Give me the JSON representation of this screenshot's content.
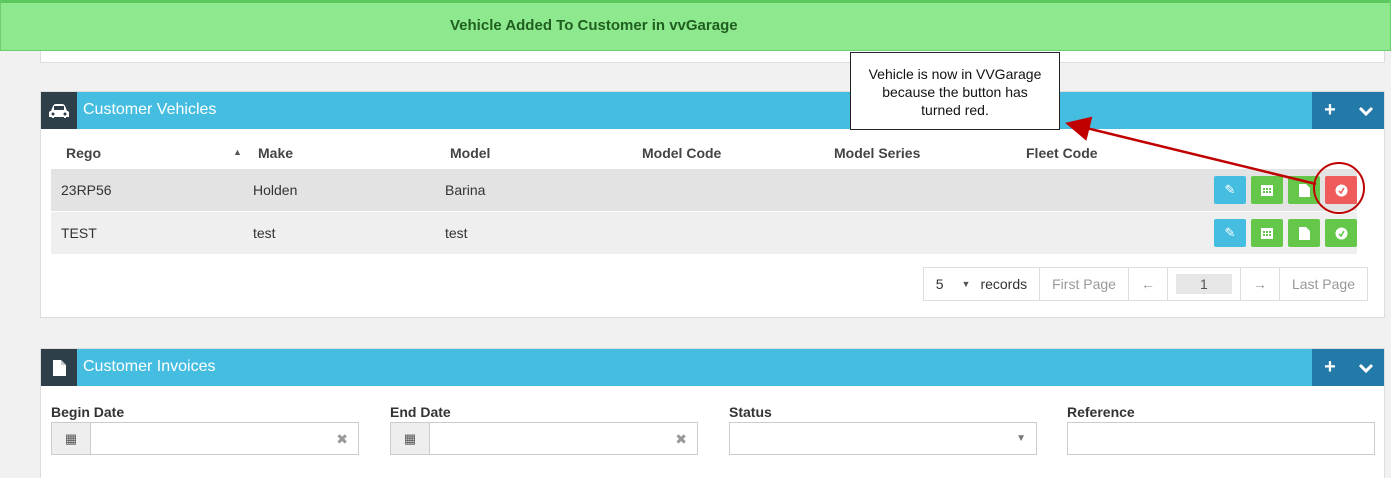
{
  "banner": {
    "message": "Vehicle Added To Customer in vvGarage"
  },
  "callout": {
    "line1": "Vehicle is now in VVGarage",
    "line2": "because the button has",
    "line3": "turned red."
  },
  "vehicles": {
    "title": "Customer Vehicles",
    "icon": "car-icon",
    "columns": [
      "Rego",
      "Make",
      "Model",
      "Model Code",
      "Model Series",
      "Fleet Code"
    ],
    "rows": [
      {
        "rego": "23RP56",
        "make": "Holden",
        "model": "Barina",
        "model_code": "",
        "model_series": "",
        "fleet_code": ""
      },
      {
        "rego": "TEST",
        "make": "test",
        "model": "test",
        "model_code": "",
        "model_series": "",
        "fleet_code": ""
      }
    ],
    "pager": {
      "page_size": "5",
      "records_label": "records",
      "first": "First Page",
      "prev": "←",
      "current": "1",
      "next": "→",
      "last": "Last Page"
    }
  },
  "invoices": {
    "title": "Customer Invoices",
    "icon": "file-icon",
    "filters": {
      "begin_label": "Begin Date",
      "end_label": "End Date",
      "status_label": "Status",
      "reference_label": "Reference"
    }
  },
  "colors": {
    "banner": "#8ee88e",
    "header": "#45bde0",
    "accent_dark": "#237aa8",
    "edit": "#45bde0",
    "green": "#65c74a",
    "red": "#ef5b5b"
  }
}
